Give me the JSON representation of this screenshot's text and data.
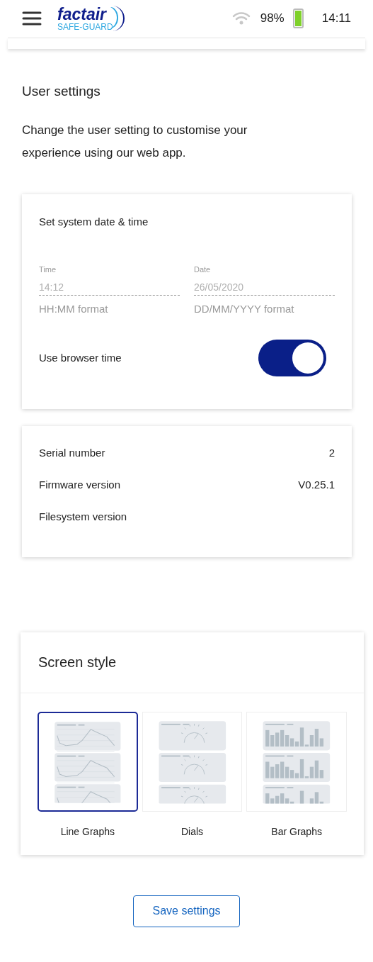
{
  "header": {
    "logo_name": "factair",
    "logo_tagline": "SAFE-GUARD",
    "battery_percent": "98%",
    "time": "14:11"
  },
  "page": {
    "title": "User settings",
    "description": "Change the user setting to customise your experience using our web app."
  },
  "datetime_card": {
    "title": "Set system date & time",
    "fields": [
      {
        "label": "Time",
        "placeholder": "14:12",
        "hint": "HH:MM format"
      },
      {
        "label": "Date",
        "placeholder": "26/05/2020",
        "hint": "DD/MM/YYYY format"
      }
    ],
    "toggle": {
      "label": "Use browser time",
      "on": true
    }
  },
  "info_card": {
    "rows": [
      {
        "label": "Serial number",
        "value": "2"
      },
      {
        "label": "Firmware version",
        "value": "V0.25.1"
      },
      {
        "label": "Filesystem version"
      }
    ]
  },
  "screen_style": {
    "title": "Screen style",
    "options": [
      {
        "kind": "line",
        "label": "Line Graphs",
        "selected": true
      },
      {
        "kind": "dials",
        "label": "Dials",
        "selected": false
      },
      {
        "kind": "bar",
        "label": "Bar Graphs",
        "selected": false
      }
    ]
  },
  "save_button": "Save settings"
}
